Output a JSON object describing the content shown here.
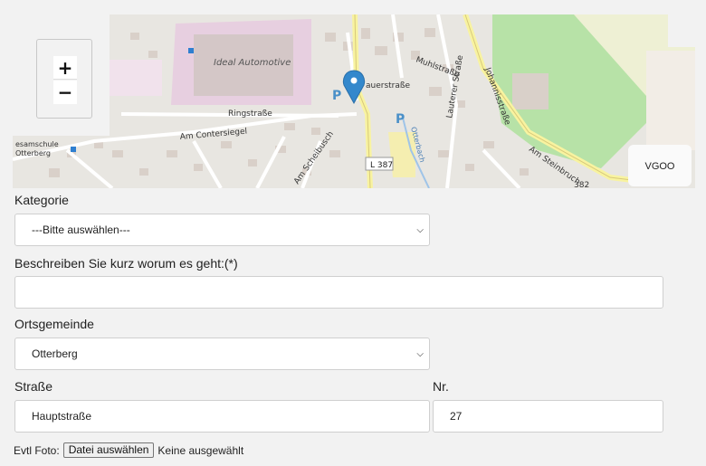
{
  "map": {
    "zoom_in_label": "+",
    "zoom_out_label": "−",
    "attribution": "VGOO",
    "street_labels": [
      "Ideal Automotive",
      "Ringstraße",
      "Am Contersiegel",
      "Am Scheibusch",
      "Muhlstraße",
      "Lauterer Straße",
      "Johannisstraße",
      "Am Steinbruch",
      "L 387",
      "esamschule",
      "Otterberg",
      "auerstraße",
      "Otterbach",
      "382"
    ],
    "parking_label": "P",
    "colors": {
      "park": "#b7e2a7",
      "road_major": "#f8f3a0",
      "industrial": "#e7cfe0",
      "building": "#d9d0c9",
      "marker": "#3388cc"
    }
  },
  "form": {
    "kategorie": {
      "label": "Kategorie",
      "value": "---Bitte auswählen---"
    },
    "beschreibung": {
      "label": "Beschreiben Sie kurz worum es geht:(*)",
      "value": ""
    },
    "ortsgemeinde": {
      "label": "Ortsgemeinde",
      "value": "Otterberg"
    },
    "strasse": {
      "label": "Straße",
      "value": "Hauptstraße"
    },
    "nr": {
      "label": "Nr.",
      "value": "27"
    },
    "foto": {
      "label": "Evtl Foto:",
      "button": "Datei auswählen",
      "status": "Keine ausgewählt"
    }
  }
}
